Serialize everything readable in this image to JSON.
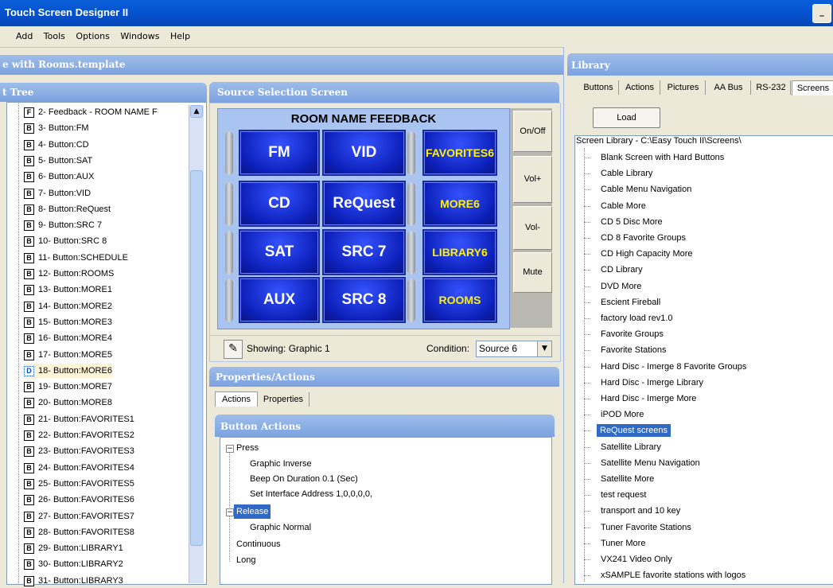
{
  "window": {
    "title": "Touch Screen Designer II",
    "minimize": "_"
  },
  "menu": [
    "Add",
    "Tools",
    "Options",
    "Windows",
    "Help"
  ],
  "doc_header": "e with Rooms.template",
  "object_tree": {
    "title": "t Tree",
    "items": [
      {
        "icon": "F",
        "label": "2- Feedback - ROOM NAME F"
      },
      {
        "icon": "B",
        "label": "3- Button:FM"
      },
      {
        "icon": "B",
        "label": "4- Button:CD"
      },
      {
        "icon": "B",
        "label": "5- Button:SAT"
      },
      {
        "icon": "B",
        "label": "6- Button:AUX"
      },
      {
        "icon": "B",
        "label": "7- Button:VID"
      },
      {
        "icon": "B",
        "label": "8- Button:ReQuest"
      },
      {
        "icon": "B",
        "label": "9- Button:SRC 7"
      },
      {
        "icon": "B",
        "label": "10- Button:SRC 8"
      },
      {
        "icon": "B",
        "label": "11- Button:SCHEDULE"
      },
      {
        "icon": "B",
        "label": "12- Button:ROOMS"
      },
      {
        "icon": "B",
        "label": "13- Button:MORE1"
      },
      {
        "icon": "B",
        "label": "14- Button:MORE2"
      },
      {
        "icon": "B",
        "label": "15- Button:MORE3"
      },
      {
        "icon": "B",
        "label": "16- Button:MORE4"
      },
      {
        "icon": "B",
        "label": "17- Button:MORE5"
      },
      {
        "icon": "D",
        "label": "18- Button:MORE6"
      },
      {
        "icon": "B",
        "label": "19- Button:MORE7"
      },
      {
        "icon": "B",
        "label": "20- Button:MORE8"
      },
      {
        "icon": "B",
        "label": "21- Button:FAVORITES1"
      },
      {
        "icon": "B",
        "label": "22- Button:FAVORITES2"
      },
      {
        "icon": "B",
        "label": "23- Button:FAVORITES3"
      },
      {
        "icon": "B",
        "label": "24- Button:FAVORITES4"
      },
      {
        "icon": "B",
        "label": "25- Button:FAVORITES5"
      },
      {
        "icon": "B",
        "label": "26- Button:FAVORITES6"
      },
      {
        "icon": "B",
        "label": "27- Button:FAVORITES7"
      },
      {
        "icon": "B",
        "label": "28- Button:FAVORITES8"
      },
      {
        "icon": "B",
        "label": "29- Button:LIBRARY1"
      },
      {
        "icon": "B",
        "label": "30- Button:LIBRARY2"
      },
      {
        "icon": "B",
        "label": "31- Button:LIBRARY3"
      }
    ]
  },
  "source_screen": {
    "title": "Source Selection Screen",
    "feedback": "ROOM NAME FEEDBACK",
    "buttons": [
      "FM",
      "VID",
      "FAVORITES6",
      "CD",
      "ReQuest",
      "MORE6",
      "SAT",
      "SRC 7",
      "LIBRARY6",
      "AUX",
      "SRC 8",
      "ROOMS"
    ],
    "side_buttons": [
      "On/Off",
      "Vol+",
      "Vol-",
      "Mute"
    ],
    "showing": "Showing: Graphic 1",
    "condition_label": "Condition:",
    "condition_value": "Source 6"
  },
  "properties": {
    "title": "Properties/Actions",
    "tabs": [
      "Actions",
      "Properties"
    ],
    "actions_title": "Button Actions",
    "press": "Press",
    "press_items": [
      "Graphic Inverse",
      "Beep On  Duration  0.1 (Sec)",
      "Set Interface Address 1,0,0,0,0,"
    ],
    "release": "Release",
    "release_items": [
      "Graphic Normal"
    ],
    "other": [
      "Continuous",
      "Long"
    ]
  },
  "library": {
    "title": "Library",
    "tabs": [
      "Buttons",
      "Actions",
      "Pictures",
      "AA Bus",
      "RS-232",
      "Screens"
    ],
    "load": "Load",
    "path": "Screen Library - C:\\Easy Touch II\\Screens\\",
    "items": [
      "Blank Screen with Hard Buttons",
      "Cable Library",
      "Cable Menu Navigation",
      "Cable More",
      "CD 5 Disc More",
      "CD 8 Favorite Groups",
      "CD High Capacity More",
      "CD Library",
      "DVD More",
      "Escient Fireball",
      "factory load rev1.0",
      "Favorite Groups",
      "Favorite Stations",
      "Hard Disc - Imerge 8 Favorite Groups",
      "Hard Disc - Imerge Library",
      "Hard Disc - Imerge More",
      "iPOD More",
      "ReQuest screens",
      "Satellite Library",
      "Satellite Menu Navigation",
      "Satellite More",
      "test request",
      "transport and 10 key",
      "Tuner Favorite Stations",
      "Tuner More",
      "VX241 Video Only",
      "xSAMPLE favorite stations with logos"
    ],
    "selected_index": 17
  }
}
